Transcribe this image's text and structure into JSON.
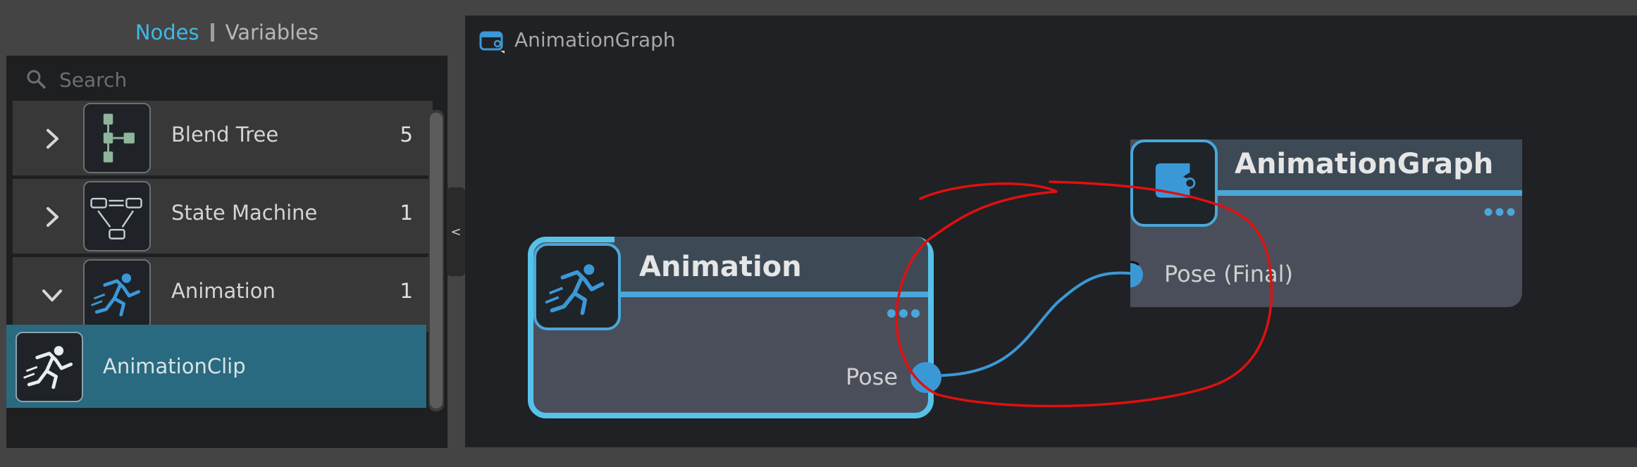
{
  "left_panel": {
    "tabs": [
      {
        "label": "Nodes",
        "active": true
      },
      {
        "label": "Variables",
        "active": false
      }
    ],
    "search": {
      "placeholder": "Search",
      "value": ""
    },
    "rows": [
      {
        "label": "Blend Tree",
        "count": "5",
        "icon": "blend-tree-icon",
        "expanded": false
      },
      {
        "label": "State Machine",
        "count": "1",
        "icon": "state-machine-icon",
        "expanded": false
      },
      {
        "label": "Animation",
        "count": "1",
        "icon": "running-figure-icon",
        "expanded": true
      }
    ],
    "selected_item": {
      "label": "AnimationClip",
      "icon": "running-figure-icon"
    },
    "collapse_label": "<"
  },
  "graph": {
    "tab_title": "AnimationGraph",
    "nodes": {
      "animation": {
        "title": "Animation",
        "output_port": "Pose",
        "icon": "running-figure-icon"
      },
      "animation_graph": {
        "title": "AnimationGraph",
        "input_port": "Pose (Final)",
        "icon": "graph-output-icon"
      }
    }
  },
  "colors": {
    "accent": "#3fb9e8",
    "node_border_selected": "#56c2ea",
    "port": "#3b98d7",
    "selected_row": "#2a6a80",
    "annotation": "#e01010"
  }
}
